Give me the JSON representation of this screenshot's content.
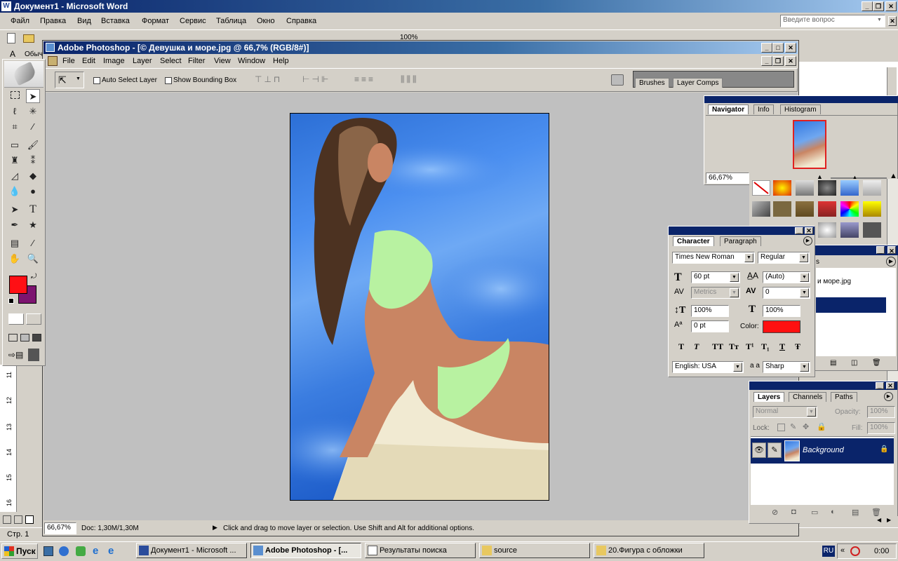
{
  "word": {
    "title": "Документ1 - Microsoft Word",
    "menu": [
      "Файл",
      "Правка",
      "Вид",
      "Вставка",
      "Формат",
      "Сервис",
      "Таблица",
      "Окно",
      "Справка"
    ],
    "help_placeholder": "Введите вопрос",
    "zoom": "100%",
    "style": "Обыч",
    "page_status": "Стр. 1",
    "ruler_marks": [
      "11",
      "12",
      "13",
      "14",
      "15",
      "16"
    ]
  },
  "ps": {
    "title": "Adobe Photoshop - [© Девушка и море.jpg @ 66,7% (RGB/8#)]",
    "menu": [
      "File",
      "Edit",
      "Image",
      "Layer",
      "Select",
      "Filter",
      "View",
      "Window",
      "Help"
    ],
    "options": {
      "auto_select": "Auto Select Layer",
      "show_bbox": "Show Bounding Box"
    },
    "well_tabs": [
      "Brushes",
      "Layer Comps"
    ],
    "status": {
      "zoom": "66,67%",
      "doc": "Doc: 1,30M/1,30M",
      "hint": "Click and drag to move layer or selection.  Use Shift and Alt for additional options."
    },
    "fg_color": "#ff0f14",
    "bg_color": "#7d1470"
  },
  "navigator": {
    "tabs": [
      "Navigator",
      "Info",
      "Histogram"
    ],
    "zoom": "66,67%"
  },
  "character": {
    "tabs": [
      "Character",
      "Paragraph"
    ],
    "font": "Times New Roman",
    "style": "Regular",
    "size": "60 pt",
    "leading": "(Auto)",
    "kerning": "Metrics",
    "tracking": "0",
    "vscale": "100%",
    "hscale": "100%",
    "baseline": "0 pt",
    "color_label": "Color:",
    "color": "#ff1010",
    "language": "English: USA",
    "aa_label": "a a",
    "antialias": "Sharp",
    "type_buttons": [
      "T",
      "T",
      "TT",
      "Tт",
      "T¹",
      "T₁",
      "T",
      "Ŧ"
    ]
  },
  "history": {
    "snapshot": "и море.jpg",
    "tab_end": "s"
  },
  "layers": {
    "tabs": [
      "Layers",
      "Channels",
      "Paths"
    ],
    "blend": "Normal",
    "opacity_label": "Opacity:",
    "opacity": "100%",
    "lock_label": "Lock:",
    "fill_label": "Fill:",
    "fill": "100%",
    "layer_name": "Background"
  },
  "taskbar": {
    "start": "Пуск",
    "items": [
      "Документ1 - Microsoft ...",
      "Adobe Photoshop - [...",
      "Результаты поиска",
      "source",
      "20.Фигура с обложки"
    ],
    "lang": "RU",
    "clock": "0:00"
  }
}
